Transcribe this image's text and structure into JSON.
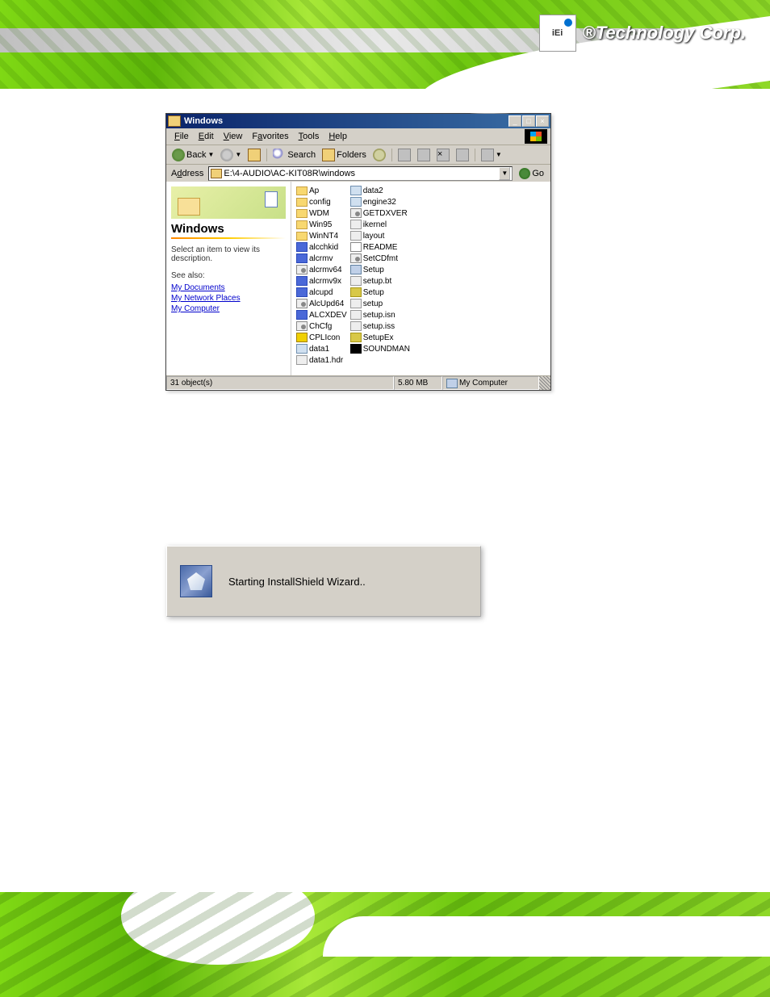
{
  "brand": {
    "logo_letters": "iEi",
    "marker": "®",
    "name": "Technology Corp."
  },
  "explorer": {
    "title": "Windows",
    "menus": {
      "file": "File",
      "edit": "Edit",
      "view": "View",
      "favorites": "Favorites",
      "tools": "Tools",
      "help": "Help"
    },
    "toolbar": {
      "back": "Back",
      "search": "Search",
      "folders": "Folders"
    },
    "address": {
      "label": "Address",
      "value": "E:\\4-AUDIO\\AC-KIT08R\\windows",
      "go": "Go"
    },
    "leftpane": {
      "title": "Windows",
      "description": "Select an item to view its description.",
      "seealso": "See also:",
      "links": {
        "docs": "My Documents",
        "net": "My Network Places",
        "comp": "My Computer"
      }
    },
    "files_col1": [
      {
        "name": "Ap",
        "type": "folder"
      },
      {
        "name": "config",
        "type": "folder"
      },
      {
        "name": "WDM",
        "type": "folder"
      },
      {
        "name": "Win95",
        "type": "folder"
      },
      {
        "name": "WinNT4",
        "type": "folder"
      },
      {
        "name": "alcchkid",
        "type": "exe"
      },
      {
        "name": "alcrmv",
        "type": "exe"
      },
      {
        "name": "alcrmv64",
        "type": "config"
      },
      {
        "name": "alcrmv9x",
        "type": "exe"
      },
      {
        "name": "alcupd",
        "type": "exe"
      },
      {
        "name": "AlcUpd64",
        "type": "config"
      },
      {
        "name": "ALCXDEV",
        "type": "exe"
      },
      {
        "name": "ChCfg",
        "type": "config"
      },
      {
        "name": "CPLIcon",
        "type": "speaker"
      },
      {
        "name": "data1",
        "type": "data"
      },
      {
        "name": "data1.hdr",
        "type": "gen"
      }
    ],
    "files_col2": [
      {
        "name": "data2",
        "type": "data"
      },
      {
        "name": "engine32",
        "type": "data"
      },
      {
        "name": "GETDXVER",
        "type": "config"
      },
      {
        "name": "ikernel",
        "type": "gen"
      },
      {
        "name": "layout",
        "type": "gen"
      },
      {
        "name": "README",
        "type": "txt"
      },
      {
        "name": "SetCDfmt",
        "type": "config"
      },
      {
        "name": "Setup",
        "type": "setup"
      },
      {
        "name": "setup.bt",
        "type": "gen"
      },
      {
        "name": "Setup",
        "type": "dll"
      },
      {
        "name": "setup",
        "type": "gen"
      },
      {
        "name": "setup.isn",
        "type": "gen"
      },
      {
        "name": "setup.iss",
        "type": "gen"
      },
      {
        "name": "SetupEx",
        "type": "dll"
      },
      {
        "name": "SOUNDMAN",
        "type": "sound"
      }
    ],
    "status": {
      "objects": "31 object(s)",
      "size": "5.80 MB",
      "location": "My Computer"
    }
  },
  "installshield": {
    "message": "Starting InstallShield Wizard.."
  }
}
